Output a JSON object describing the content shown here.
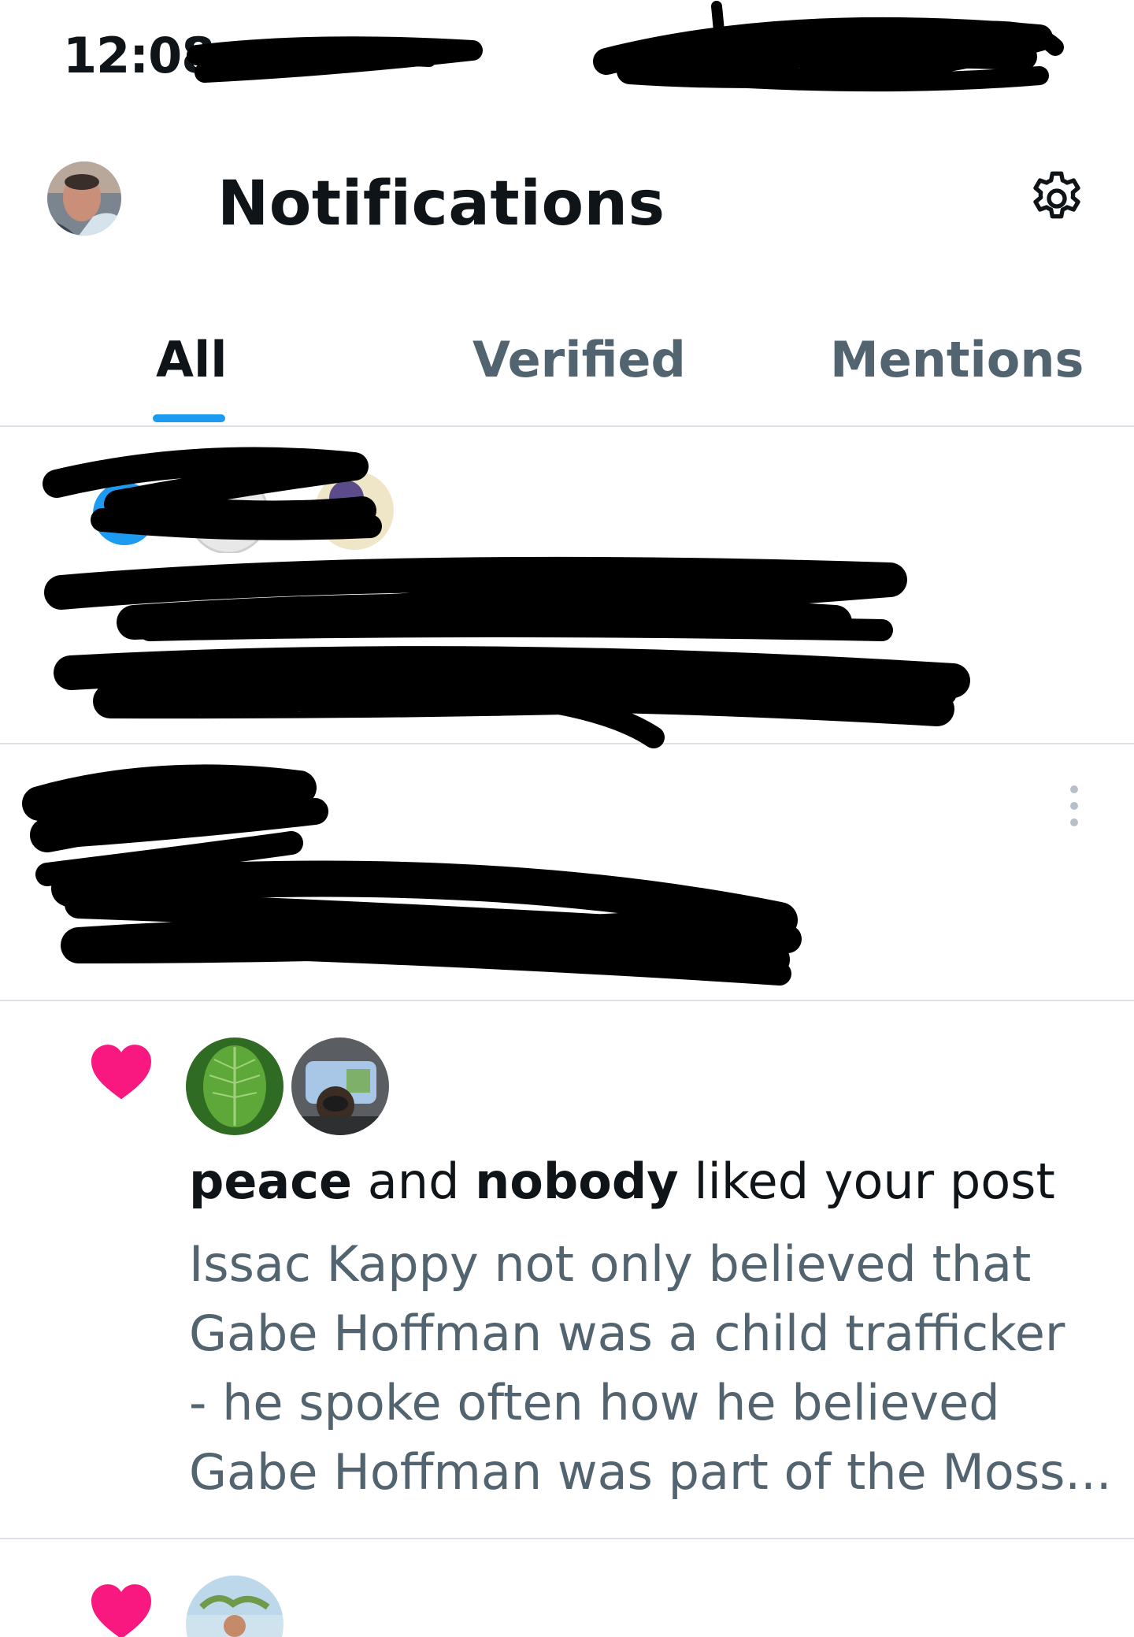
{
  "status_bar": {
    "time": "12:08"
  },
  "header": {
    "title": "Notifications",
    "avatar_icon": "profile-avatar",
    "settings_icon": "gear-icon"
  },
  "tabs": [
    {
      "label": "All",
      "active": true
    },
    {
      "label": "Verified",
      "active": false
    },
    {
      "label": "Mentions",
      "active": false
    }
  ],
  "notifications": [
    {
      "redacted": true
    },
    {
      "redacted": true,
      "more_icon": "more-vertical-icon"
    },
    {
      "type": "like",
      "icon": "heart-icon",
      "users": [
        "peace",
        "nobody"
      ],
      "connector": "and",
      "action": "liked your post",
      "preview_lines": [
        "Issac Kappy not only believed that",
        "Gabe Hoffman was a child trafficker",
        "- he spoke often how he believed",
        "Gabe Hoffman was part of the Moss..."
      ]
    },
    {
      "type": "like",
      "icon": "heart-icon"
    }
  ],
  "colors": {
    "accent": "#1d9bf0",
    "like": "#f91880",
    "text": "#0f1419",
    "secondary_text": "#536471",
    "divider": "#dbe1e6"
  }
}
